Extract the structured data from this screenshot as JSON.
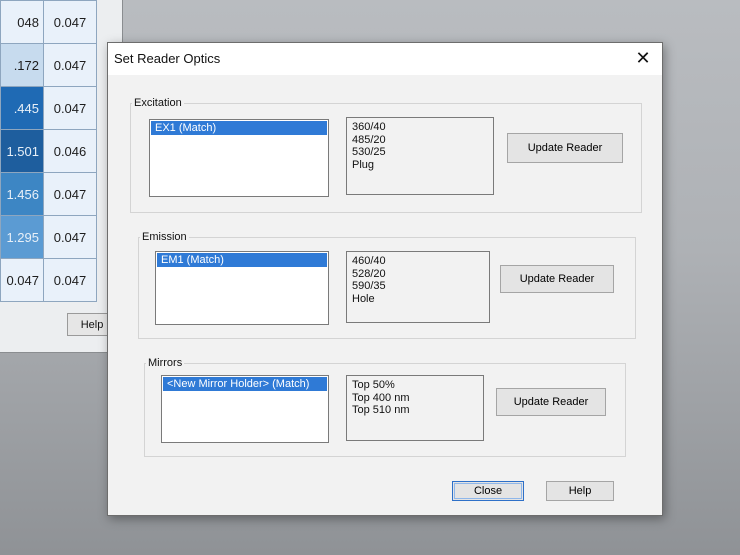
{
  "background_window": {
    "grid": [
      [
        "048",
        "0.047"
      ],
      [
        ".172",
        "0.047"
      ],
      [
        ".445",
        "0.047"
      ],
      [
        "1.501",
        "0.046"
      ],
      [
        "1.456",
        "0.047"
      ],
      [
        "1.295",
        "0.047"
      ],
      [
        "0.047",
        "0.047"
      ]
    ],
    "cell_colors": [
      [
        "#e9f1fa",
        "#e9f1fa"
      ],
      [
        "#c7dbee",
        "#e9f1fa"
      ],
      [
        "#1f6ab4",
        "#e9f1fa"
      ],
      [
        "#1e5e9e",
        "#e9f1fa"
      ],
      [
        "#3d86c4",
        "#e9f1fa"
      ],
      [
        "#5b9bd3",
        "#e9f1fa"
      ],
      [
        "#e9f1fa",
        "#e9f1fa"
      ]
    ],
    "help_label": "Help"
  },
  "dialog": {
    "title": "Set Reader Optics",
    "close_icon": "close-icon",
    "sections": [
      {
        "label": "Excitation",
        "selected_item": "EX1 (Match)",
        "filters": [
          "360/40",
          "485/20",
          "530/25",
          "Plug"
        ],
        "update_label": "Update Reader"
      },
      {
        "label": "Emission",
        "selected_item": "EM1 (Match)",
        "filters": [
          "460/40",
          "528/20",
          "590/35",
          "Hole"
        ],
        "update_label": "Update Reader"
      },
      {
        "label": "Mirrors",
        "selected_item": "<New Mirror Holder> (Match)",
        "filters": [
          "Top 50%",
          "Top 400 nm",
          "Top 510 nm"
        ],
        "update_label": "Update Reader"
      }
    ],
    "close_label": "Close",
    "help_label": "Help"
  }
}
